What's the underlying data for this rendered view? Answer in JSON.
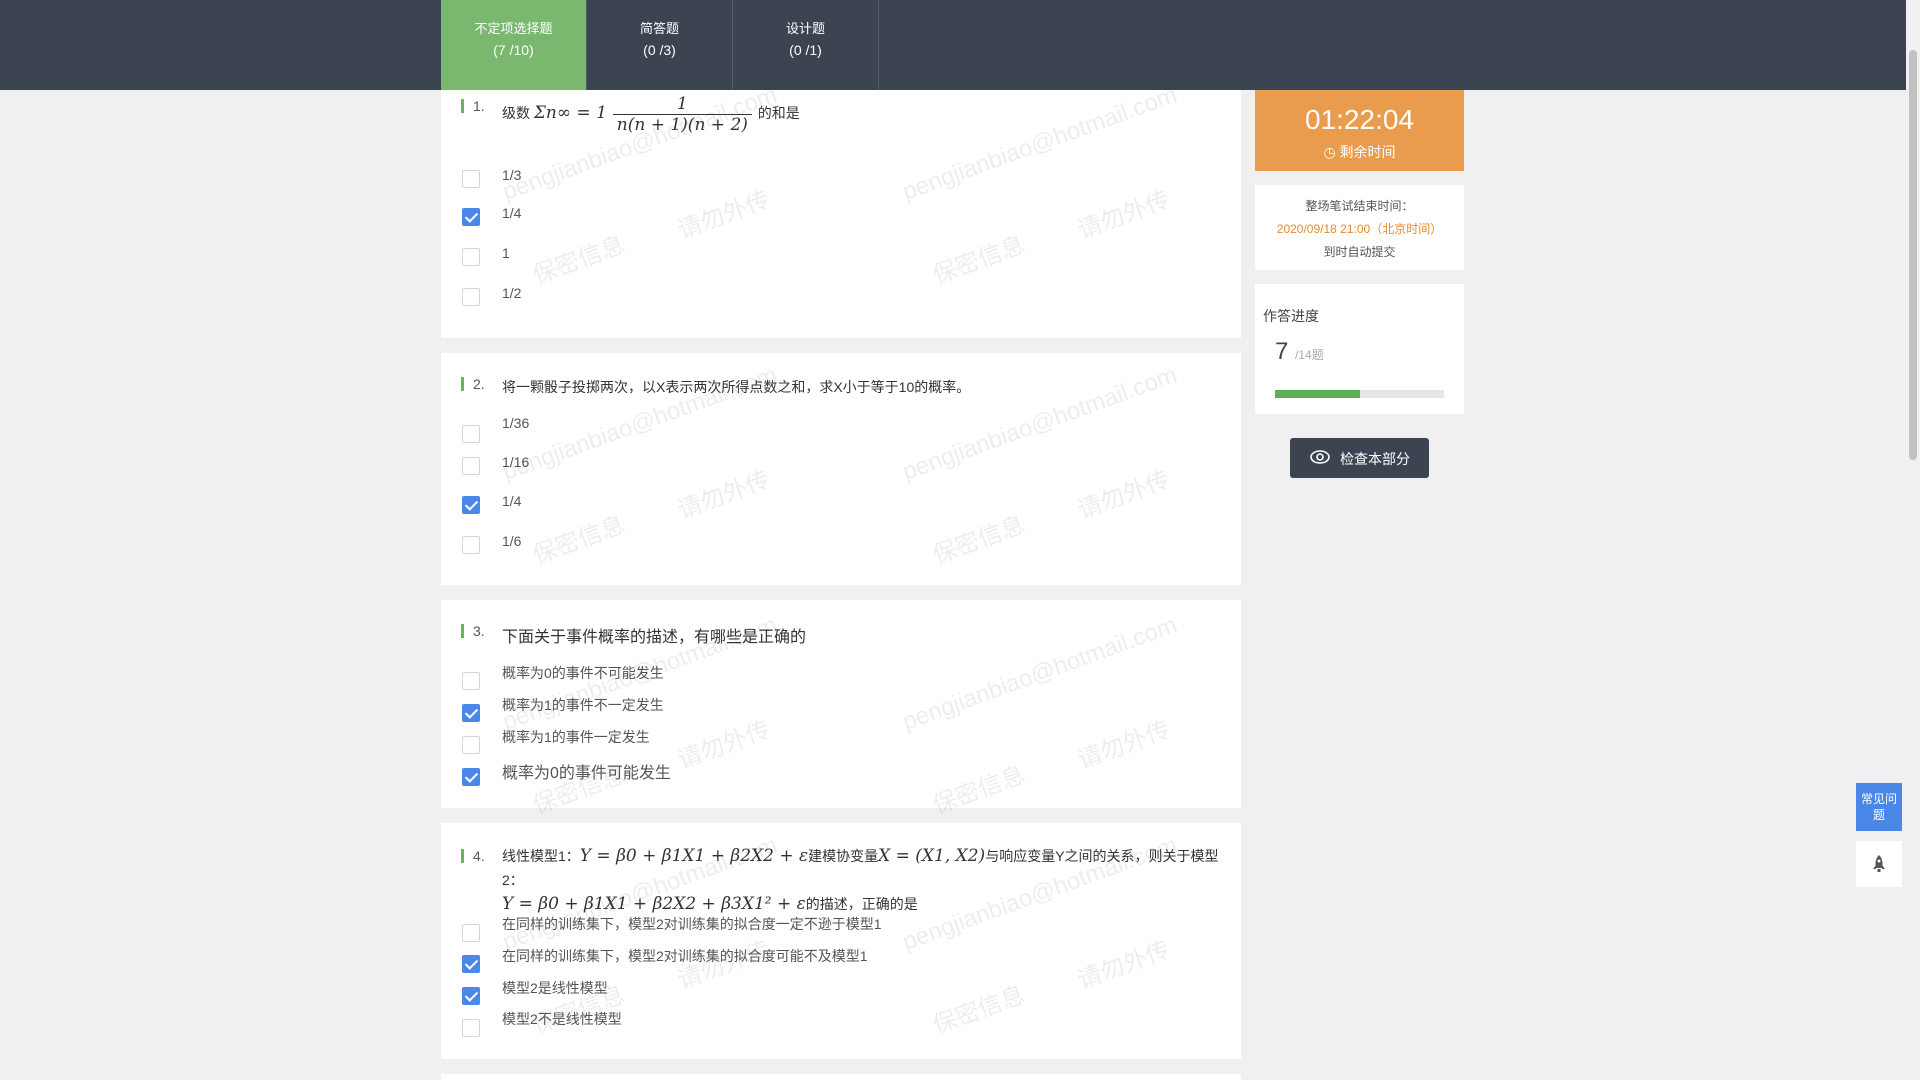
{
  "tabs": [
    {
      "label": "不定项选择题",
      "count": "(7 /10)"
    },
    {
      "label": "简答题",
      "count": "(0 /3)"
    },
    {
      "label": "设计题",
      "count": "(0 /1)"
    }
  ],
  "watermark": {
    "email": "pengjianbiao@hotmail.com",
    "secret": "保密信息",
    "noshare": "请勿外传"
  },
  "questions": [
    {
      "num": "1.",
      "stem_prefix": "级数",
      "stem_math": "Σn∞ = 1",
      "frac_num": "1",
      "frac_den": "n(n + 1)(n + 2)",
      "stem_suffix": "的和是",
      "options": [
        {
          "text": "1/3",
          "checked": false
        },
        {
          "text": "1/4",
          "checked": true
        },
        {
          "text": "1",
          "checked": false
        },
        {
          "text": "1/2",
          "checked": false
        }
      ]
    },
    {
      "num": "2.",
      "stem": "将一颗骰子投掷两次，以X表示两次所得点数之和，求X小于等于10的概率。",
      "options": [
        {
          "text": "1/36",
          "checked": false
        },
        {
          "text": "1/16",
          "checked": false
        },
        {
          "text": "1/4",
          "checked": true
        },
        {
          "text": "1/6",
          "checked": false
        }
      ]
    },
    {
      "num": "3.",
      "stem": "下面关于事件概率的描述，有哪些是正确的",
      "options": [
        {
          "text": "概率为0的事件不可能发生",
          "checked": false
        },
        {
          "text": "概率为1的事件不一定发生",
          "checked": true
        },
        {
          "text": "概率为1的事件一定发生",
          "checked": false
        },
        {
          "text": "概率为0的事件可能发生",
          "checked": true
        }
      ]
    },
    {
      "num": "4.",
      "stem_a": "线性模型1：",
      "math_a": "Y = β0 + β1X1 + β2X2 + ε",
      "stem_b": "建模协变量",
      "math_b": "X = (X1, X2)",
      "stem_c": "与响应变量Y之间的关系，则关于模型2：",
      "math_c": "Y = β0 + β1X1 + β2X2 + β3X1² + ε",
      "stem_d": "的描述，正确的是",
      "options": [
        {
          "text": "在同样的训练集下，模型2对训练集的拟合度一定不逊于模型1",
          "checked": false
        },
        {
          "text": "在同样的训练集下，模型2对训练集的拟合度可能不及模型1",
          "checked": true
        },
        {
          "text": "模型2是线性模型",
          "checked": true
        },
        {
          "text": "模型2不是线性模型",
          "checked": false
        }
      ]
    }
  ],
  "timer": {
    "time": "01:22:04",
    "label": "剩余时间"
  },
  "end_info": {
    "line1": "整场笔试结束时间：",
    "line2": "2020/09/18 21:00（北京时间）",
    "line3": "到时自动提交"
  },
  "progress": {
    "title": "作答进度",
    "answered": "7",
    "total": "/14题",
    "fraction": 0.5
  },
  "check_button": "检查本部分",
  "faq": "常见问题",
  "colors": {
    "accent_green": "#7ab86f",
    "timer_orange": "#e99b4e",
    "check_blue": "#4a87e8",
    "nav_dark": "#3d4451"
  }
}
